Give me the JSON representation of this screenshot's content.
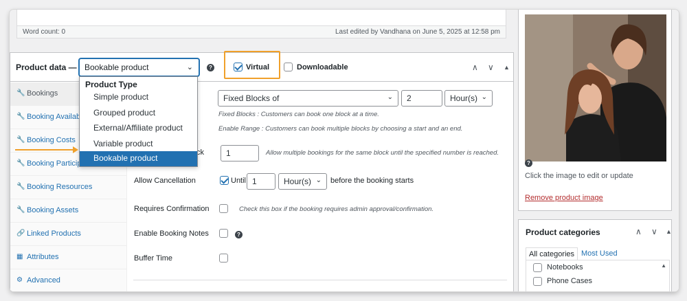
{
  "editor": {
    "word_count": "Word count: 0",
    "last_edited": "Last edited by Vandhana on June 5, 2025 at 12:58 pm"
  },
  "product_data": {
    "title": "Product data —",
    "selected_type": "Bookable product",
    "virtual_label": "Virtual",
    "virtual_checked": true,
    "downloadable_label": "Downloadable",
    "downloadable_checked": false
  },
  "dropdown": {
    "group_label": "Product Type",
    "options": [
      "Simple product",
      "Grouped product",
      "External/Affiliate product",
      "Variable product",
      "Bookable product"
    ],
    "selected_index": 4
  },
  "tabs": [
    {
      "label": "Bookings",
      "icon": "wrench-icon",
      "active": true
    },
    {
      "label": "Booking Availab",
      "icon": "wrench-icon"
    },
    {
      "label": "Booking Costs",
      "icon": "wrench-icon"
    },
    {
      "label": "Booking Particip",
      "icon": "wrench-icon"
    },
    {
      "label": "Booking Resources",
      "icon": "wrench-icon"
    },
    {
      "label": "Booking Assets",
      "icon": "wrench-icon"
    },
    {
      "label": "Linked Products",
      "icon": "link-icon"
    },
    {
      "label": "Attributes",
      "icon": "list-icon"
    },
    {
      "label": "Advanced",
      "icon": "gear-icon"
    }
  ],
  "booking": {
    "block_type": "Fixed Blocks of",
    "block_value": "2",
    "block_unit": "Hour(s)",
    "fixed_note": "Fixed Blocks : Customers can book one block at a time.",
    "range_note": "Enable Range : Customers can book multiple blocks by choosing a start and an end.",
    "per_block_label_fragment": "ck",
    "per_block_value": "1",
    "per_block_note": "Allow multiple bookings for the same block until the specified number is reached.",
    "cancel_label": "Allow Cancellation",
    "cancel_checked": true,
    "until_label": "Until",
    "cancel_value": "1",
    "cancel_unit": "Hour(s)",
    "cancel_suffix": "before the booking starts",
    "confirm_label": "Requires Confirmation",
    "confirm_note": "Check this box if the booking requires admin approval/confirmation.",
    "notes_label": "Enable Booking Notes",
    "buffer_label": "Buffer Time"
  },
  "product_image": {
    "hint": "Click the image to edit or update",
    "remove_link": "Remove product image"
  },
  "categories": {
    "title": "Product categories",
    "tab_all": "All categories",
    "tab_most_used": "Most Used",
    "items": [
      "Notebooks",
      "Phone Cases"
    ]
  },
  "colors": {
    "accent": "#2271b1",
    "highlight": "#f0a02a",
    "danger": "#b32d2e"
  }
}
